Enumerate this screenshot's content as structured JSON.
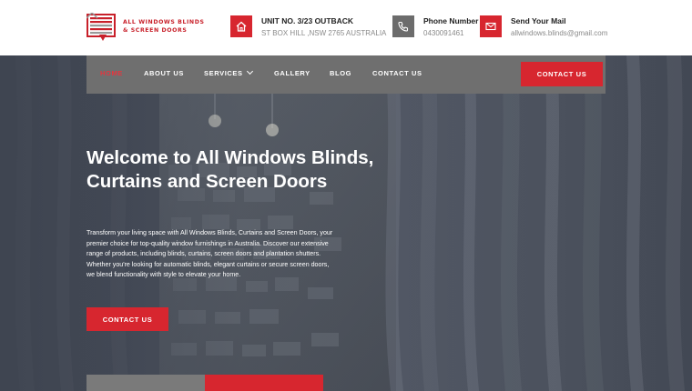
{
  "brand": {
    "line1": "All Windows Blinds",
    "line2": "& Screen Doors",
    "accent": "#d7262f"
  },
  "contact_info": [
    {
      "icon": "home-icon",
      "title": "UNIT NO. 3/23 OUTBACK",
      "subtitle": "ST BOX HILL ,NSW 2765 AUSTRALIA"
    },
    {
      "icon": "phone-icon",
      "title": "Phone Number",
      "subtitle": "0430091461"
    },
    {
      "icon": "mail-icon",
      "title": "Send Your Mail",
      "subtitle": "allwindows.blinds@gmail.com"
    }
  ],
  "nav": {
    "items": [
      {
        "label": "Home",
        "active": true
      },
      {
        "label": "About Us"
      },
      {
        "label": "Services",
        "dropdown": true
      },
      {
        "label": "Gallery"
      },
      {
        "label": "Blog"
      },
      {
        "label": "Contact Us"
      }
    ],
    "cta": "Contact Us"
  },
  "hero": {
    "title": "Welcome to All Windows Blinds, Curtains and Screen Doors",
    "text": "Transform your living space with All Windows Blinds, Curtains and Screen Doors, your premier choice for top-quality window furnishings in Australia. Discover our extensive range of products, including blinds, curtains, screen doors and plantation shutters. Whether you're looking for automatic blinds, elegant curtains or secure screen doors, we blend functionality with style to elevate your home.",
    "cta": "Contact Us"
  }
}
